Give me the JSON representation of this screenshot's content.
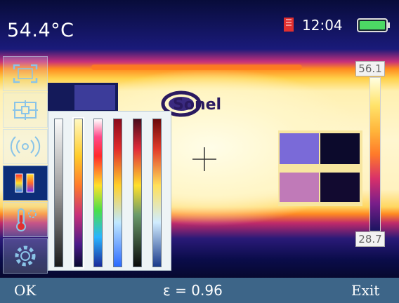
{
  "header": {
    "temperature": "54.4°C",
    "time": "12:04"
  },
  "image": {
    "logo_text": "Sonel"
  },
  "scale": {
    "max": "56.1",
    "min": "28.7"
  },
  "menu": {
    "items": [
      {
        "name": "measurement-area-icon"
      },
      {
        "name": "point-measurement-icon"
      },
      {
        "name": "emissivity-wave-icon"
      },
      {
        "name": "palette-icon",
        "active": true
      },
      {
        "name": "thermometer-settings-icon"
      },
      {
        "name": "gear-icon"
      }
    ]
  },
  "palettes": [
    {
      "name": "grayscale-inverted"
    },
    {
      "name": "iron"
    },
    {
      "name": "rainbow"
    },
    {
      "name": "red-yellow-blue"
    },
    {
      "name": "red-black"
    },
    {
      "name": "white-hot"
    }
  ],
  "footer": {
    "ok_label": "OK",
    "emissivity": "ε = 0.96",
    "exit_label": "Exit"
  },
  "colors": {
    "footer_bg": "#3d6588",
    "active_menu": "#0d2e78"
  }
}
